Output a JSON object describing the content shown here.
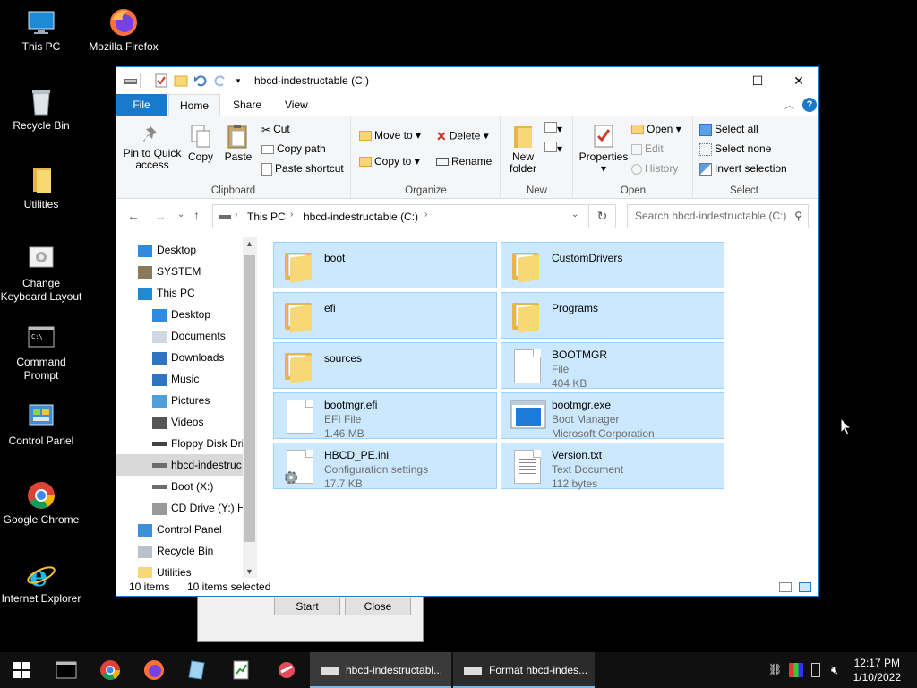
{
  "desktop": {
    "icons": [
      {
        "label": "This PC",
        "icon": "this-pc-icon"
      },
      {
        "label": "Mozilla Firefox",
        "icon": "firefox-icon"
      },
      {
        "label": "Recycle Bin",
        "icon": "recycle-bin-icon"
      },
      {
        "label": "Utilities",
        "icon": "folder-icon"
      },
      {
        "label": "Change Keyboard Layout",
        "icon": "keyboard-layout-icon"
      },
      {
        "label": "Command Prompt",
        "icon": "command-prompt-icon"
      },
      {
        "label": "Control Panel",
        "icon": "control-panel-icon"
      },
      {
        "label": "Google Chrome",
        "icon": "chrome-icon"
      },
      {
        "label": "Internet Explorer",
        "icon": "internet-explorer-icon"
      }
    ]
  },
  "background_dialog": {
    "start_label": "Start",
    "close_label": "Close"
  },
  "window": {
    "title": "hbcd-indestructable (C:)",
    "controls": {
      "minimize": "—",
      "maximize": "☐",
      "close": "✕"
    },
    "tabs": {
      "file": "File",
      "home": "Home",
      "share": "Share",
      "view": "View"
    },
    "ribbon": {
      "clipboard": {
        "label": "Clipboard",
        "pin": "Pin to Quick access",
        "pin_line1": "Pin to Quick",
        "pin_line2": "access",
        "copy": "Copy",
        "paste": "Paste",
        "cut": "Cut",
        "copy_path": "Copy path",
        "paste_shortcut": "Paste shortcut"
      },
      "organize": {
        "label": "Organize",
        "move_to": "Move to",
        "copy_to": "Copy to",
        "delete": "Delete",
        "rename": "Rename"
      },
      "new": {
        "label": "New",
        "new_folder_line1": "New",
        "new_folder_line2": "folder"
      },
      "open": {
        "label": "Open",
        "properties": "Properties",
        "open": "Open",
        "edit": "Edit",
        "history": "History"
      },
      "select": {
        "label": "Select",
        "select_all": "Select all",
        "select_none": "Select none",
        "invert": "Invert selection"
      }
    },
    "address": {
      "crumbs": [
        "This PC",
        "hbcd-indestructable (C:)"
      ],
      "search_placeholder": "Search hbcd-indestructable (C:)"
    },
    "nav": [
      {
        "label": "Desktop",
        "indent": 0,
        "icon": "desktop-icon"
      },
      {
        "label": "SYSTEM",
        "indent": 0,
        "icon": "user-icon"
      },
      {
        "label": "This PC",
        "indent": 0,
        "icon": "this-pc-icon"
      },
      {
        "label": "Desktop",
        "indent": 1,
        "icon": "desktop-icon"
      },
      {
        "label": "Documents",
        "indent": 1,
        "icon": "documents-icon"
      },
      {
        "label": "Downloads",
        "indent": 1,
        "icon": "downloads-icon"
      },
      {
        "label": "Music",
        "indent": 1,
        "icon": "music-icon"
      },
      {
        "label": "Pictures",
        "indent": 1,
        "icon": "pictures-icon"
      },
      {
        "label": "Videos",
        "indent": 1,
        "icon": "videos-icon"
      },
      {
        "label": "Floppy Disk Dri",
        "indent": 1,
        "icon": "floppy-icon"
      },
      {
        "label": "hbcd-indestruc",
        "indent": 1,
        "icon": "drive-icon",
        "selected": true
      },
      {
        "label": "Boot (X:)",
        "indent": 1,
        "icon": "drive-icon"
      },
      {
        "label": "CD Drive (Y:) H",
        "indent": 1,
        "icon": "cd-drive-icon"
      },
      {
        "label": "Control Panel",
        "indent": 0,
        "icon": "control-panel-icon"
      },
      {
        "label": "Recycle Bin",
        "indent": 0,
        "icon": "recycle-bin-icon"
      },
      {
        "label": "Utilities",
        "indent": 0,
        "icon": "folder-icon"
      }
    ],
    "files": [
      {
        "name": "boot",
        "type": "folder",
        "lines": []
      },
      {
        "name": "CustomDrivers",
        "type": "folder",
        "lines": []
      },
      {
        "name": "efi",
        "type": "folder",
        "lines": []
      },
      {
        "name": "Programs",
        "type": "folder",
        "lines": []
      },
      {
        "name": "sources",
        "type": "folder",
        "lines": []
      },
      {
        "name": "BOOTMGR",
        "type": "file",
        "lines": [
          "File",
          "404 KB"
        ]
      },
      {
        "name": "bootmgr.efi",
        "type": "file",
        "lines": [
          "EFI File",
          "1.46 MB"
        ]
      },
      {
        "name": "bootmgr.exe",
        "type": "exe",
        "lines": [
          "Boot Manager",
          "Microsoft Corporation"
        ]
      },
      {
        "name": "HBCD_PE.ini",
        "type": "ini",
        "lines": [
          "Configuration settings",
          "17.7 KB"
        ]
      },
      {
        "name": "Version.txt",
        "type": "txt",
        "lines": [
          "Text Document",
          "112 bytes"
        ]
      }
    ],
    "status": {
      "count": "10 items",
      "selected": "10 items selected"
    }
  },
  "taskbar": {
    "buttons": [
      {
        "label": "hbcd-indestructabl...",
        "icon": "drive-icon"
      },
      {
        "label": "Format hbcd-indes...",
        "icon": "drive-icon"
      }
    ],
    "clock": {
      "time": "12:17 PM",
      "date": "1/10/2022"
    }
  },
  "colors": {
    "accent": "#1979ca",
    "selection": "#cce8ff",
    "selection_border": "#99d1ff"
  }
}
